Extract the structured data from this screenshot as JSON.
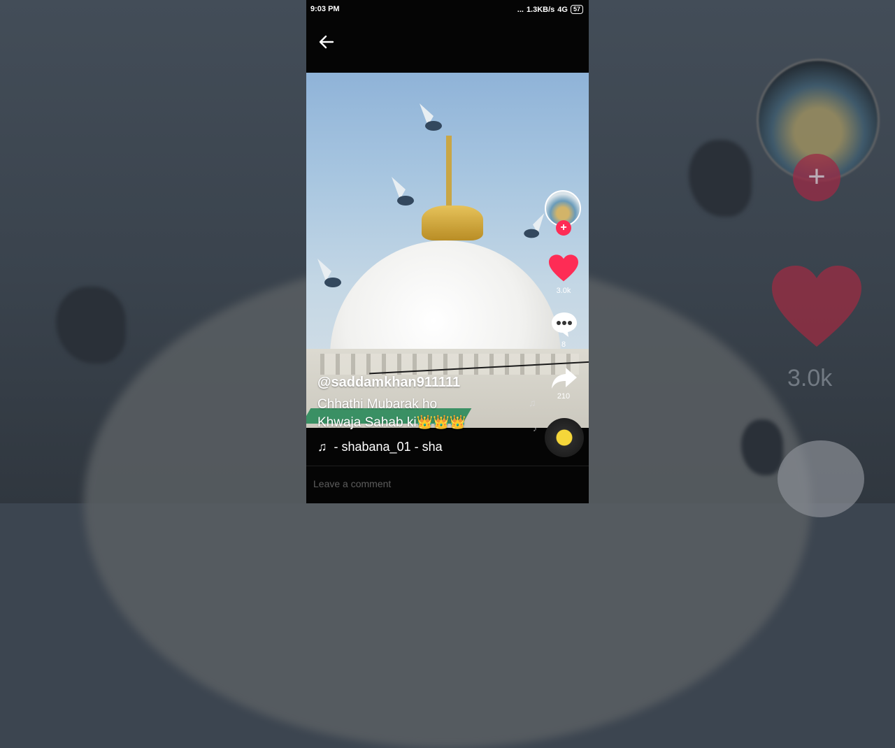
{
  "status_bar": {
    "time": "9:03 PM",
    "dots": "...",
    "network_speed": "1.3KB/s",
    "signal": "4G",
    "battery": "57"
  },
  "video": {
    "username": "@saddamkhan911111",
    "caption_line1": "Chhathi Mubarak ho",
    "caption_line2": "Khwaja Sahab ki👑👑👑",
    "music_text": "- shabana_01 - sha"
  },
  "actions": {
    "likes": "3.0k",
    "comments": "8",
    "shares": "210"
  },
  "comment_input": {
    "placeholder": "Leave a comment"
  },
  "backdrop": {
    "likes": "3.0k"
  },
  "colors": {
    "accent": "#fe2c55",
    "background": "#050505"
  },
  "icons": [
    "back-arrow-icon",
    "heart-icon",
    "comment-icon",
    "share-icon",
    "music-note-icon",
    "plus-icon"
  ]
}
